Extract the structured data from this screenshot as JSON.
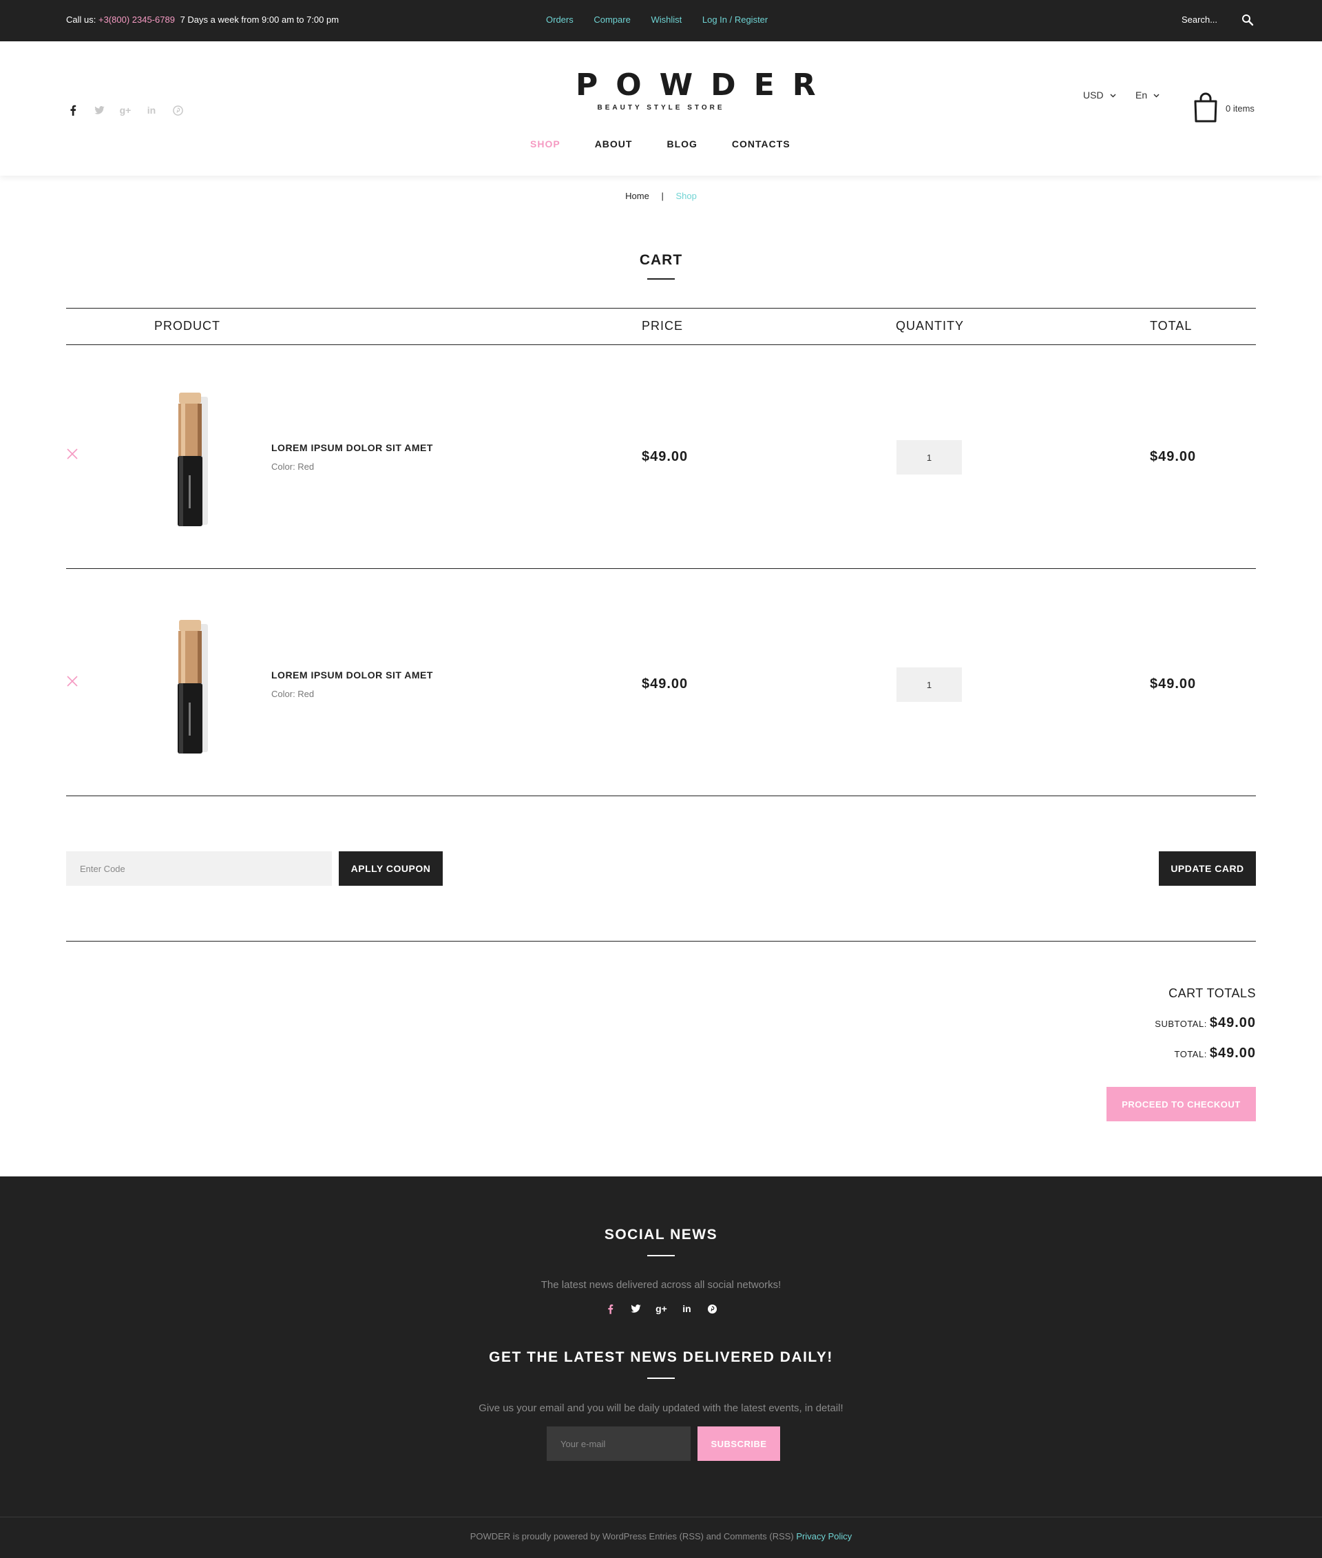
{
  "topbar": {
    "call_prefix": "Call us:",
    "phone": "+3(800) 2345-6789",
    "hours": "7 Days a week from 9:00 am to 7:00 pm",
    "links": [
      "Orders",
      "Compare",
      "Wishlist",
      "Log In / Register"
    ],
    "search_placeholder": "Search..."
  },
  "header": {
    "logo_text": "POWDER",
    "logo_tagline": "BEAUTY STYLE STORE",
    "social_icons": [
      "facebook-icon",
      "twitter-icon",
      "google-plus-icon",
      "linkedin-icon",
      "pinterest-icon"
    ],
    "nav": [
      "SHOP",
      "ABOUT",
      "BLOG",
      "CONTACTS"
    ],
    "active_nav": "SHOP",
    "currency": "USD",
    "language": "En",
    "cart_count_label": "0 items"
  },
  "breadcrumb": {
    "home": "Home",
    "separator": "|",
    "current": "Shop"
  },
  "cart": {
    "title": "CART",
    "columns": {
      "product": "PRODUCT",
      "price": "PRICE",
      "quantity": "QUANTITY",
      "total": "TOTAL"
    },
    "items": [
      {
        "name": "LOREM IPSUM DOLOR SIT AMET",
        "variant": "Color: Red",
        "price": "$49.00",
        "quantity": "1",
        "total": "$49.00"
      },
      {
        "name": "LOREM IPSUM DOLOR SIT AMET",
        "variant": "Color: Red",
        "price": "$49.00",
        "quantity": "1",
        "total": "$49.00"
      }
    ],
    "coupon_placeholder": "Enter Code",
    "apply_coupon_label": "APLLY COUPON",
    "update_label": "UPDATE CARD"
  },
  "totals": {
    "title": "CART TOTALS",
    "subtotal_label": "SUBTOTAL:",
    "subtotal_value": "$49.00",
    "total_label": "TOTAL:",
    "total_value": "$49.00",
    "checkout_label": "PROCEED TO CHECKOUT"
  },
  "footer": {
    "social_title": "SOCIAL NEWS",
    "social_text": "The latest news delivered across all social networks!",
    "social_icons": [
      "facebook-icon",
      "twitter-icon",
      "google-plus-icon",
      "linkedin-icon",
      "pinterest-icon"
    ],
    "newsletter_title": "GET THE LATEST NEWS DELIVERED DAILY!",
    "newsletter_text": "Give us your email and you will be daily updated with the latest events, in detail!",
    "email_placeholder": "Your e-mail",
    "subscribe_label": "SUBSCRIBE",
    "copyright_text": "POWDER is proudly powered by WordPress Entries (RSS) and Comments (RSS)",
    "privacy_link": "Privacy Policy"
  },
  "colors": {
    "accent_pink": "#f59ac2",
    "accent_teal": "#6fd3d3",
    "dark": "#222222"
  }
}
